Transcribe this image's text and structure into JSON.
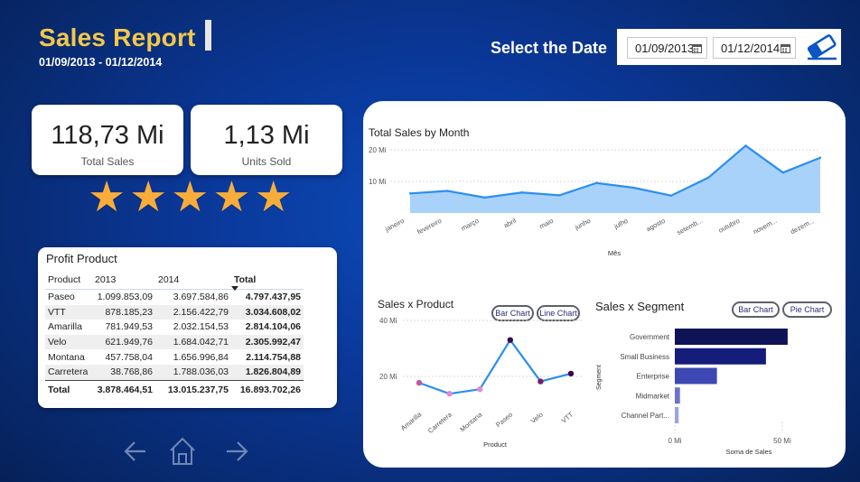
{
  "header": {
    "title": "Sales Report",
    "date_range": "01/09/2013 - 01/12/2014",
    "select_date_label": "Select the Date",
    "start_date": "01/09/2013",
    "end_date": "01/12/2014"
  },
  "kpis": {
    "total_sales": {
      "value": "118,73 Mi",
      "label": "Total Sales"
    },
    "units_sold": {
      "value": "1,13 Mi",
      "label": "Units Sold"
    }
  },
  "rating": {
    "stars": 5,
    "max": 5,
    "color": "#f8ad3a"
  },
  "profit_table": {
    "title": "Profit Product",
    "headers": [
      "Product",
      "2013",
      "2014",
      "Total"
    ],
    "rows": [
      {
        "product": "Paseo",
        "y2013": "1.099.853,09",
        "y2014": "3.697.584,86",
        "total": "4.797.437,95"
      },
      {
        "product": "VTT",
        "y2013": "878.185,23",
        "y2014": "2.156.422,79",
        "total": "3.034.608,02"
      },
      {
        "product": "Amarilla",
        "y2013": "781.949,53",
        "y2014": "2.032.154,53",
        "total": "2.814.104,06"
      },
      {
        "product": "Velo",
        "y2013": "621.949,76",
        "y2014": "1.684.042,71",
        "total": "2.305.992,47"
      },
      {
        "product": "Montana",
        "y2013": "457.758,04",
        "y2014": "1.656.996,84",
        "total": "2.114.754,88"
      },
      {
        "product": "Carretera",
        "y2013": "38.768,86",
        "y2014": "1.788.036,03",
        "total": "1.826.804,89"
      }
    ],
    "total_row": {
      "product": "Total",
      "y2013": "3.878.464,51",
      "y2014": "13.015.237,75",
      "total": "16.893.702,26"
    }
  },
  "nav": {
    "back_icon": "arrow-left-icon",
    "home_icon": "home-icon",
    "next_icon": "arrow-right-icon"
  },
  "chart_data": [
    {
      "type": "area",
      "title": "Total Sales by Month",
      "xlabel": "Mês",
      "ylabel": "",
      "categories": [
        "janeiro",
        "fevereiro",
        "março",
        "abril",
        "maio",
        "junho",
        "julho",
        "agosto",
        "setemb...",
        "outubro",
        "novem...",
        "dezem..."
      ],
      "values": [
        6.2,
        7.0,
        4.9,
        6.5,
        5.6,
        9.5,
        8.0,
        5.5,
        11.2,
        21.3,
        12.8,
        17.5
      ],
      "yticks": [
        10,
        20
      ],
      "ytick_labels": [
        "10 Mi",
        "20 Mi"
      ],
      "ylim": [
        0,
        24
      ],
      "grid": true,
      "color": "#2b8ff0",
      "fill": "#a9d2fb"
    },
    {
      "type": "line",
      "title": "Sales x Product",
      "xlabel": "Product",
      "ylabel": "",
      "categories": [
        "Amarilla",
        "Carretera",
        "Montana",
        "Paseo",
        "Velo",
        "VTT"
      ],
      "values": [
        17.7,
        13.8,
        15.4,
        33.0,
        18.2,
        21.0
      ],
      "point_colors": [
        "#c0599a",
        "#e08bd0",
        "#e08bd0",
        "#3a0a4e",
        "#7a1a6a",
        "#3a0a4e"
      ],
      "yticks": [
        20,
        40
      ],
      "ytick_labels": [
        "20 Mi",
        "40 Mi"
      ],
      "ylim": [
        10,
        40
      ],
      "grid": true,
      "color": "#2b8ff0",
      "buttons": [
        "Bar Chart",
        "Line Chart"
      ]
    },
    {
      "type": "bar",
      "orientation": "horizontal",
      "title": "Sales x Segment",
      "xlabel": "Soma de Sales",
      "ylabel": "Segment",
      "categories": [
        "Government",
        "Small Business",
        "Enterprise",
        "Midmarket",
        "Channel Part..."
      ],
      "values": [
        52.5,
        42.4,
        19.6,
        2.4,
        1.8
      ],
      "colors": [
        "#0f1457",
        "#151d7a",
        "#3e48b4",
        "#6a74cc",
        "#9ea4dd"
      ],
      "xticks": [
        0,
        50
      ],
      "xtick_labels": [
        "0 Mi",
        "50 Mi"
      ],
      "xlim": [
        0,
        58
      ],
      "buttons": [
        "Bar Chart",
        "Pie Chart"
      ]
    }
  ]
}
